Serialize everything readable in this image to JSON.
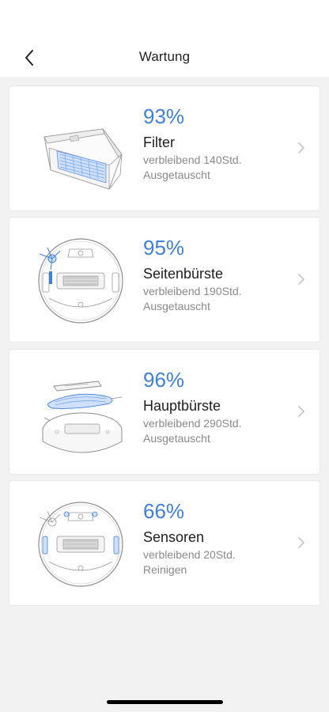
{
  "header": {
    "title": "Wartung"
  },
  "colors": {
    "accent": "#3f7fe0",
    "background": "#f2f2f2"
  },
  "items": [
    {
      "percent": "93%",
      "name": "Filter",
      "remaining": "verbleibend 140Std.",
      "status": "Ausgetauscht",
      "icon": "filter-icon"
    },
    {
      "percent": "95%",
      "name": "Seitenbürste",
      "remaining": "verbleibend 190Std.",
      "status": "Ausgetauscht",
      "icon": "side-brush-icon"
    },
    {
      "percent": "96%",
      "name": "Hauptbürste",
      "remaining": "verbleibend 290Std.",
      "status": "Ausgetauscht",
      "icon": "main-brush-icon"
    },
    {
      "percent": "66%",
      "name": "Sensoren",
      "remaining": "verbleibend 20Std.",
      "status": "Reinigen",
      "icon": "sensors-icon"
    }
  ]
}
